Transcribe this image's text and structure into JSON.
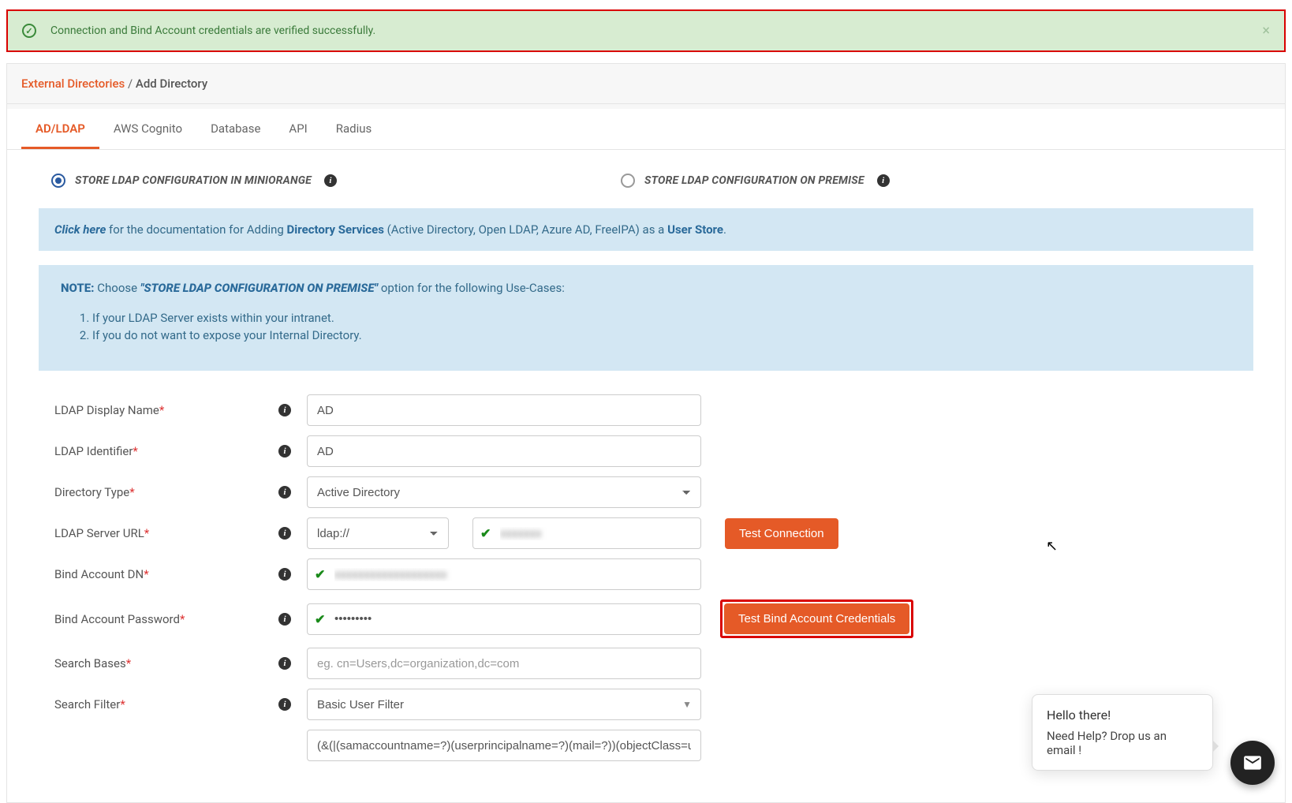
{
  "alert": {
    "message": "Connection and Bind Account credentials are verified successfully."
  },
  "breadcrumb": {
    "root": "External Directories",
    "sep": "/",
    "current": "Add Directory"
  },
  "tabs": [
    "AD/LDAP",
    "AWS Cognito",
    "Database",
    "API",
    "Radius"
  ],
  "radio": {
    "opt1": "STORE LDAP CONFIGURATION IN MINIORANGE",
    "opt2": "STORE LDAP CONFIGURATION ON PREMISE"
  },
  "info": {
    "click": "Click here",
    "text1": " for the documentation for Adding ",
    "ds": "Directory Services",
    "text2": " (Active Directory, Open LDAP, Azure AD, FreeIPA) as a ",
    "us": "User Store",
    "text3": "."
  },
  "note": {
    "label": "NOTE:",
    "pre": "  Choose ",
    "emph": "\"STORE LDAP CONFIGURATION ON PREMISE\"",
    "post": " option for the following Use-Cases:",
    "li1": "If your LDAP Server exists within your intranet.",
    "li2": "If you do not want to expose your Internal Directory."
  },
  "fields": {
    "display_name": {
      "label": "LDAP Display Name",
      "value": "AD"
    },
    "identifier": {
      "label": "LDAP Identifier",
      "value": "AD"
    },
    "dir_type": {
      "label": "Directory Type",
      "value": "Active Directory"
    },
    "server_url": {
      "label": "LDAP Server URL",
      "scheme": "ldap://",
      "host": ""
    },
    "bind_dn": {
      "label": "Bind Account DN",
      "value": ""
    },
    "bind_pw": {
      "label": "Bind Account Password",
      "value": "•••••••••"
    },
    "search_bases": {
      "label": "Search Bases",
      "placeholder": "eg. cn=Users,dc=organization,dc=com",
      "value": ""
    },
    "search_filter": {
      "label": "Search Filter",
      "value": "Basic User Filter",
      "expr": "(&(|(samaccountname=?)(userprincipalname=?)(mail=?))(objectClass=user))"
    }
  },
  "buttons": {
    "test_conn": "Test Connection",
    "test_bind": "Test Bind Account Credentials"
  },
  "chat": {
    "greet": "Hello there!",
    "sub": "Need Help? Drop us an email !"
  }
}
